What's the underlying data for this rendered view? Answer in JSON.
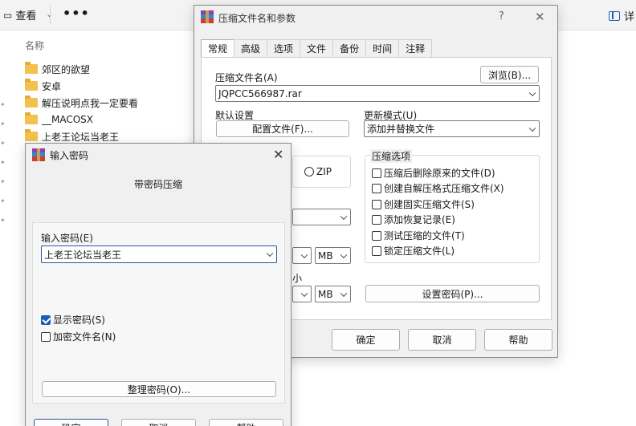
{
  "explorer": {
    "view_label": "查看",
    "more_label": "•••",
    "details_label": "详",
    "column_name": "名称",
    "folders": [
      "郊区的欲望",
      "安卓",
      "解压说明点我一定要看",
      "__MACOSX",
      "上老王论坛当老王"
    ]
  },
  "archive_dialog": {
    "title": "压缩文件名和参数",
    "help_glyph": "?",
    "close_glyph": "✕",
    "tabs": [
      "常规",
      "高级",
      "选项",
      "文件",
      "备份",
      "时间",
      "注释"
    ],
    "filename_label": "压缩文件名(A)",
    "browse_button": "浏览(B)...",
    "filename_value": "JQPCC566987.rar",
    "default_settings_label": "默认设置",
    "profiles_button": "配置文件(F)...",
    "update_mode_label": "更新模式(U)",
    "update_mode_value": "添加并替换文件",
    "zip_label": "ZIP",
    "options_group_title": "压缩选项",
    "options": [
      {
        "label": "压缩后删除原来的文件(D)",
        "checked": false
      },
      {
        "label": "创建自解压格式压缩文件(X)",
        "checked": false
      },
      {
        "label": "创建固实压缩文件(S)",
        "checked": false
      },
      {
        "label": "添加恢复记录(E)",
        "checked": false
      },
      {
        "label": "测试压缩的文件(T)",
        "checked": false
      },
      {
        "label": "锁定压缩文件(L)",
        "checked": false
      }
    ],
    "unit_mb_1": "MB",
    "unit_mb_2": "MB",
    "size_label_fragment": "小",
    "set_password_button": "设置密码(P)...",
    "ok_button": "确定",
    "cancel_button": "取消",
    "help_button": "帮助"
  },
  "password_dialog": {
    "title": "输入密码",
    "close_glyph": "✕",
    "subtitle": "带密码压缩",
    "password_label": "输入密码(E)",
    "password_value": "上老王论坛当老王",
    "show_password_label": "显示密码(S)",
    "show_password_checked": true,
    "encrypt_names_label": "加密文件名(N)",
    "encrypt_names_checked": false,
    "organize_button": "整理密码(O)...",
    "ok_button": "确定",
    "cancel_button": "取消",
    "help_button": "帮助"
  }
}
